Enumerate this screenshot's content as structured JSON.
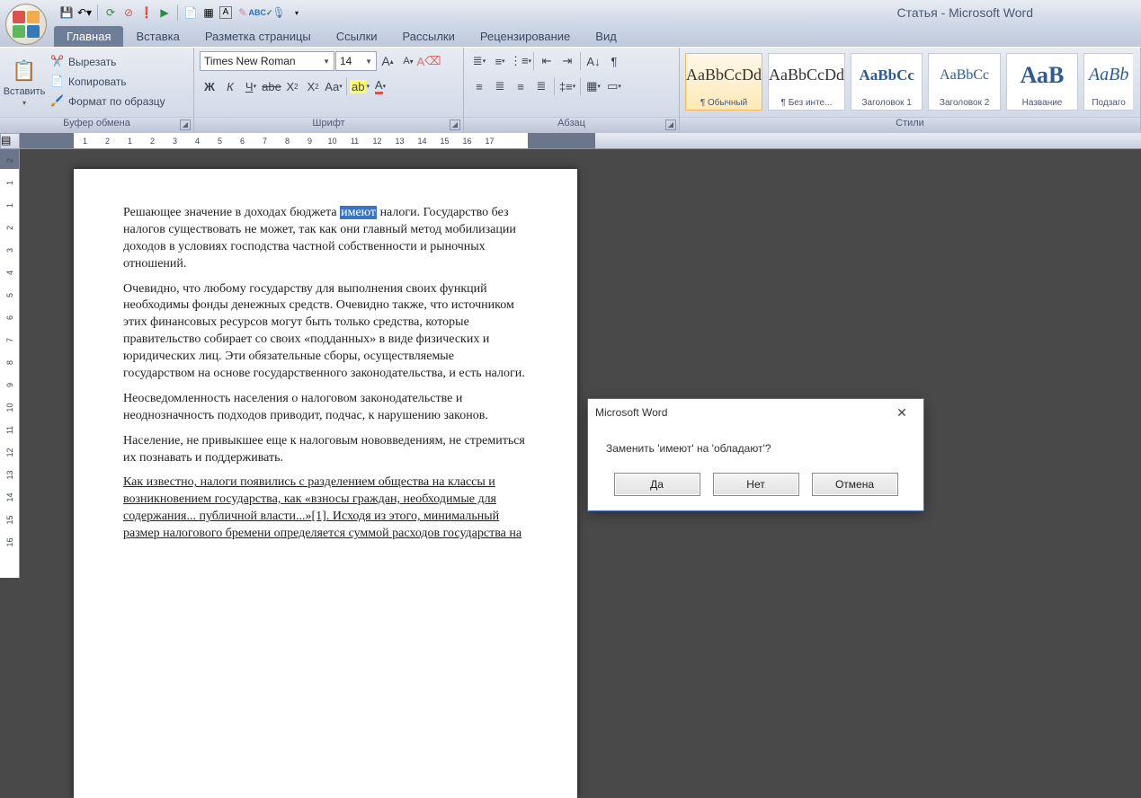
{
  "window": {
    "title": "Статья - Microsoft Word"
  },
  "qat": {
    "save": "💾",
    "undo": "↶",
    "redo": "↻",
    "stop": "⛔",
    "warn": "❗",
    "run": "▶",
    "mag": "🔍",
    "app": "📄",
    "a": "A",
    "eraser": "✎",
    "abc": "ABC",
    "mic": "🎤"
  },
  "tabs": {
    "home": "Главная",
    "insert": "Вставка",
    "layout": "Разметка страницы",
    "refs": "Ссылки",
    "mail": "Рассылки",
    "review": "Рецензирование",
    "view": "Вид"
  },
  "clipboard": {
    "group": "Буфер обмена",
    "paste": "Вставить",
    "cut": "Вырезать",
    "copy": "Копировать",
    "format": "Формат по образцу"
  },
  "font": {
    "group": "Шрифт",
    "name": "Times New Roman",
    "size": "14"
  },
  "para": {
    "group": "Абзац"
  },
  "styles": {
    "group": "Стили",
    "s1": {
      "prev": "AaBbCcDd",
      "name": "¶ Обычный"
    },
    "s2": {
      "prev": "AaBbCcDd",
      "name": "¶ Без инте..."
    },
    "s3": {
      "prev": "AaBbCc",
      "name": "Заголовок 1"
    },
    "s4": {
      "prev": "AaBbCc",
      "name": "Заголовок 2"
    },
    "s5": {
      "prev": "АаВ",
      "name": "Название"
    },
    "s6": {
      "prev": "AaBb",
      "name": "Подзаго"
    }
  },
  "doc": {
    "p1a": "Решающее значение в доходах бюджета ",
    "p1_hl": "имеют",
    "p1b": " налоги. Государство без налогов существовать не может, так как они главный метод мобилизации доходов в условиях господства частной собственности и рыночных отношений.",
    "p2": "Очевидно, что любому государству для выполнения своих функций необходимы фонды денежных средств. Очевидно также, что источником этих финансовых ресурсов могут быть только средства, которые правительство собирает со своих «подданных» в виде физических и юридических лиц. Эти обязательные сборы, осуществляемые государством на основе государственного законодательства, и есть налоги.",
    "p3": "Неосведомленность населения о налоговом законодательстве и неоднозначность подходов приводит, подчас, к нарушению законов.",
    "p4": "Население, не привыкшее еще к налоговым нововведениям, не стремиться их познавать и поддерживать.",
    "p5a": "Как известно, налоги появились с разделением общества на классы и возникновением государства, как «взносы граждан, необходимые для содержания... публичной власти...»",
    "p5ref": "[1]",
    "p5b": ". Исходя из этого, минимальный размер налогового бремени определяется суммой расходов государства на"
  },
  "dialog": {
    "title": "Microsoft Word",
    "message": "Заменить 'имеют' на 'обладают'?",
    "yes": "Да",
    "no": "Нет",
    "cancel": "Отмена"
  },
  "ruler": {
    "h": [
      "1",
      "2",
      "1",
      "2",
      "3",
      "4",
      "5",
      "6",
      "7",
      "8",
      "9",
      "10",
      "11",
      "12",
      "13",
      "14",
      "15",
      "16",
      "17"
    ],
    "v": [
      "2",
      "1",
      "1",
      "2",
      "3",
      "4",
      "5",
      "6",
      "7",
      "8",
      "9",
      "10",
      "11",
      "12",
      "13",
      "14",
      "15",
      "16"
    ]
  }
}
